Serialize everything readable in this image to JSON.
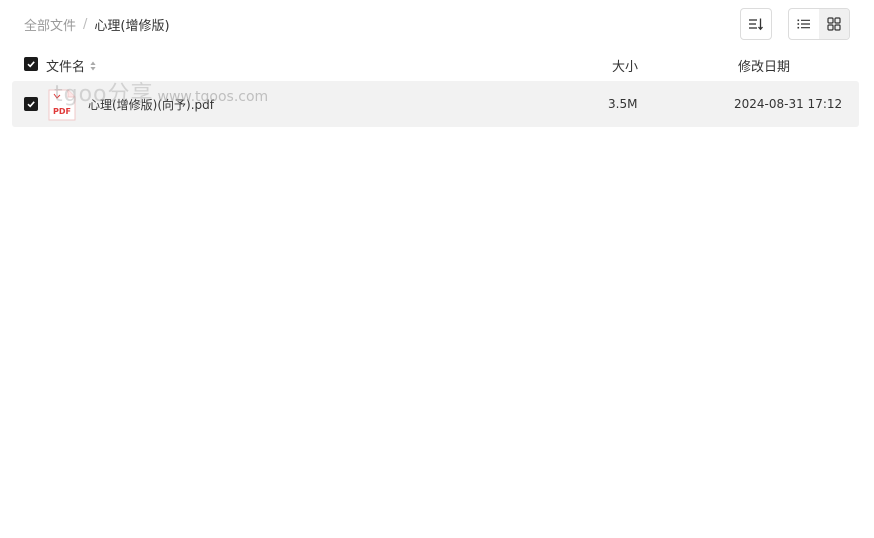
{
  "breadcrumb": {
    "root": "全部文件",
    "separator": "/",
    "current": "心理(增修版)"
  },
  "toolbar": {
    "sort_icon": "sort-icon",
    "list_view_icon": "list-view-icon",
    "grid_view_icon": "grid-view-icon",
    "active_view": "list"
  },
  "table": {
    "columns": {
      "name": "文件名",
      "size": "大小",
      "date": "修改日期"
    },
    "files": [
      {
        "name": "心理(增修版)(向予).pdf",
        "size": "3.5M",
        "modified": "2024-08-31 17:12",
        "type_badge": "PDF",
        "checked": true
      }
    ]
  },
  "watermark": {
    "brand": "tgoo分享",
    "url": "www.tgoos.com"
  },
  "colors": {
    "row_bg": "#f2f2f2",
    "checkbox": "#1a1a1a",
    "pdf_red": "#e03a3a"
  }
}
